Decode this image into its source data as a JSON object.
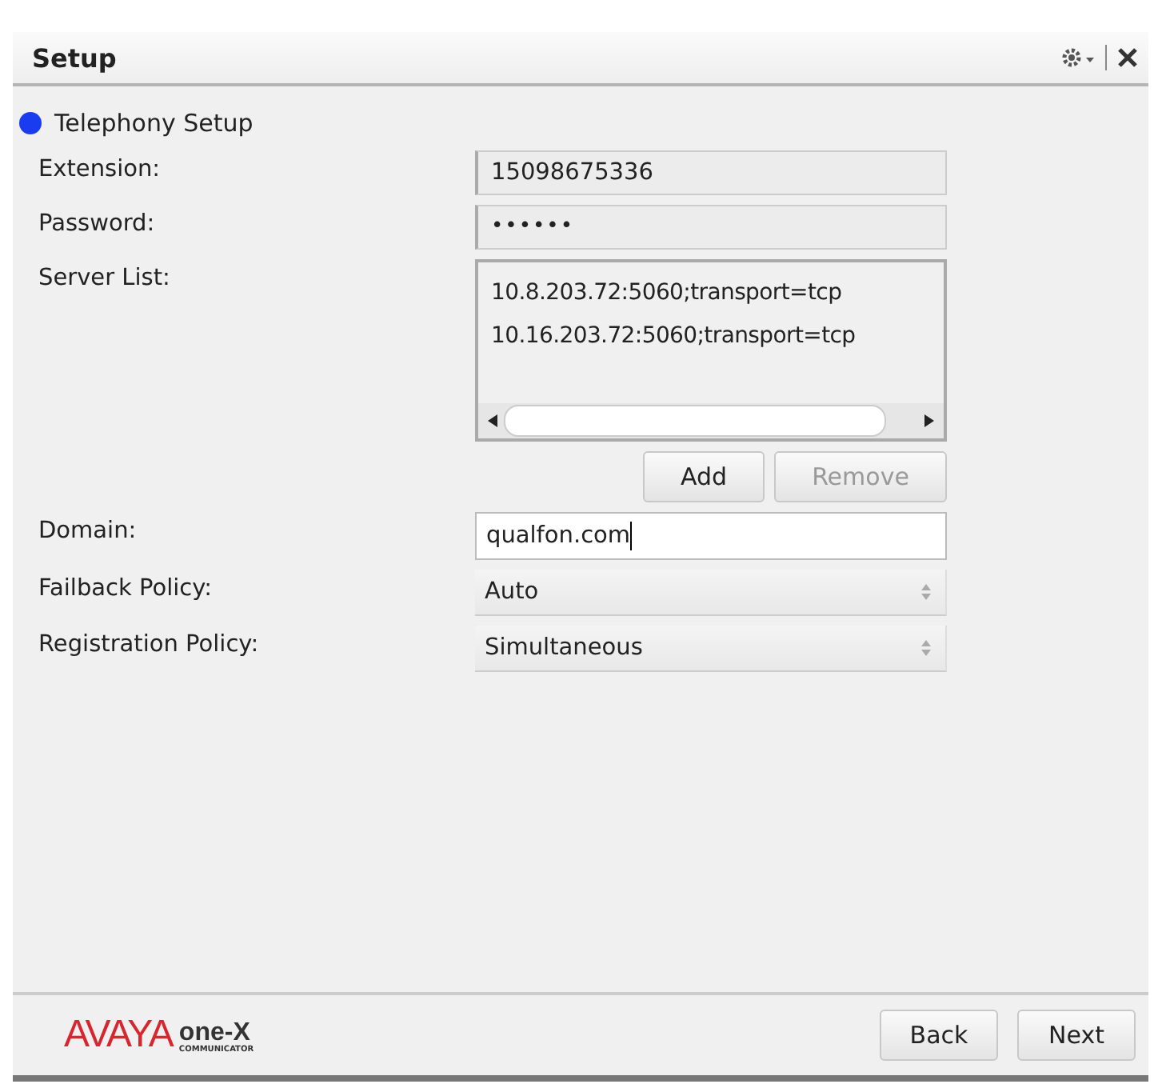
{
  "window": {
    "title": "Setup"
  },
  "section": {
    "label": "Telephony Setup",
    "color": "#1a3cf0"
  },
  "fields": [
    {
      "kind": "text",
      "label": "Extension:",
      "value": "15098675336"
    },
    {
      "kind": "password",
      "label": "Password:",
      "value": "••••••"
    },
    {
      "kind": "list",
      "label": "Server List:",
      "items": [
        "10.8.203.72:5060;transport=tcp",
        "10.16.203.72:5060;transport=tcp"
      ],
      "buttons": [
        {
          "label": "Add",
          "disabled": false
        },
        {
          "label": "Remove",
          "disabled": true
        }
      ]
    },
    {
      "kind": "input",
      "label": "Domain:",
      "value": "qualfon.com"
    },
    {
      "kind": "select",
      "label": "Failback Policy:",
      "value": "Auto"
    },
    {
      "kind": "select",
      "label": "Registration Policy:",
      "value": "Simultaneous"
    }
  ],
  "logo": {
    "brand": "AVAYA",
    "product": "one-X",
    "subtitle": "COMMUNICATOR"
  },
  "buttons": [
    {
      "label": "Back"
    },
    {
      "label": "Next"
    }
  ]
}
